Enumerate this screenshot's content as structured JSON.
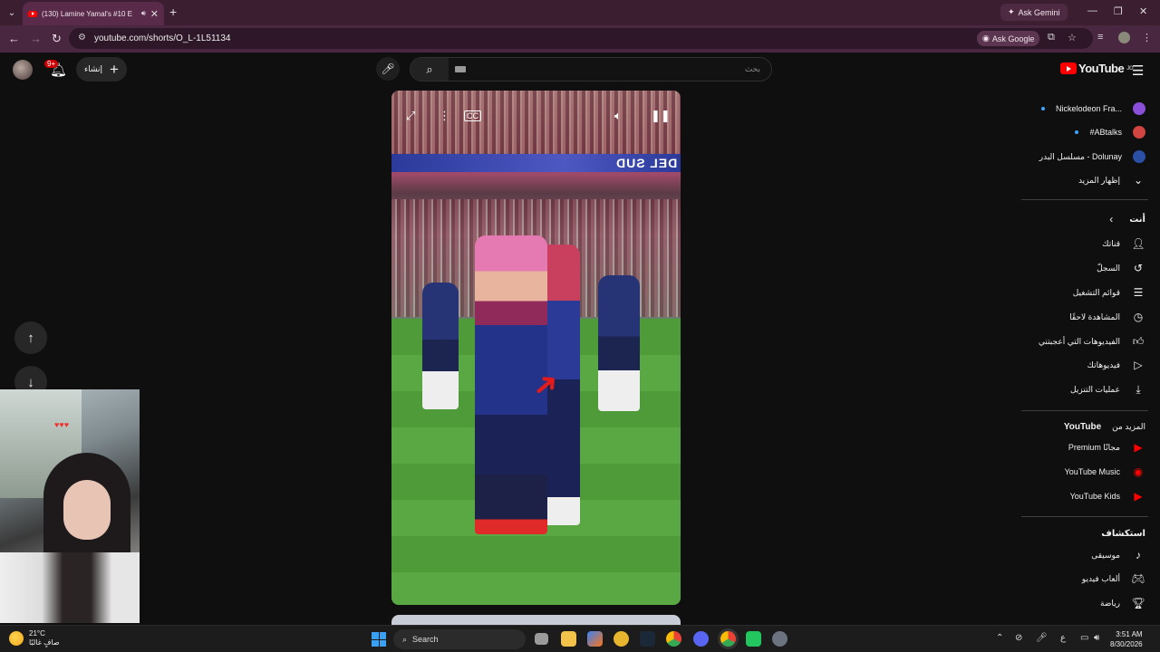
{
  "browser": {
    "tab_title": "(130) Lamine Yamal's #10 E",
    "url": "youtube.com/shorts/O_L-1L51134",
    "ask_gemini": "Ask Gemini",
    "ask_google": "Ask Google"
  },
  "youtube": {
    "logo_text": "YouTube",
    "logo_sup": "JO",
    "search_placeholder": "بحث",
    "create_label": "إنشاء",
    "notification_count": "9+"
  },
  "video": {
    "banner_text": "DEL SUD"
  },
  "sidebar": {
    "subscriptions": [
      {
        "label": "Nickelodeon Fra...",
        "color": "#8a4fd8",
        "dot": true
      },
      {
        "label": "#ABtalks",
        "color": "#d0453f",
        "dot": true
      },
      {
        "label": "مسلسل البدر - Dolunay",
        "color": "#2a4fa5",
        "dot": false
      }
    ],
    "show_more": "إظهار المزيد",
    "you_heading": "أنت",
    "you_items": [
      {
        "label": "قناتك",
        "icon": "channel-icon"
      },
      {
        "label": "السجلّ",
        "icon": "history-icon"
      },
      {
        "label": "قوائم التشغيل",
        "icon": "playlist-icon"
      },
      {
        "label": "المشاهدة لاحقًا",
        "icon": "watch-later-icon"
      },
      {
        "label": "الفيديوهات التي أعجبتني",
        "icon": "like-icon"
      },
      {
        "label": "فيديوهاتك",
        "icon": "your-videos-icon"
      },
      {
        "label": "عمليات التنزيل",
        "icon": "download-icon"
      }
    ],
    "more_heading_prefix": "المزيد من",
    "more_heading_brand": "YouTube",
    "more_items": [
      {
        "label": "Premium مجانًا",
        "icon": "premium-icon"
      },
      {
        "label": "YouTube Music",
        "icon": "music-icon"
      },
      {
        "label": "YouTube Kids",
        "icon": "kids-icon"
      }
    ],
    "explore_heading": "استكشاف",
    "explore_items": [
      {
        "label": "موسيقى",
        "icon": "note-icon"
      },
      {
        "label": "ألعاب فيديو",
        "icon": "gaming-icon"
      },
      {
        "label": "رياضة",
        "icon": "trophy-icon"
      }
    ]
  },
  "taskbar": {
    "temperature": "21°C",
    "weather": "صافٍ غالبًا",
    "search": "Search",
    "time": "3:51 AM",
    "date": "8/30/2026",
    "lang": "ع"
  },
  "colors": {
    "tabbar": "#3b1e30",
    "navbar": "#4a2740",
    "yt_red": "#ff0000",
    "background": "#0f0f0f"
  }
}
